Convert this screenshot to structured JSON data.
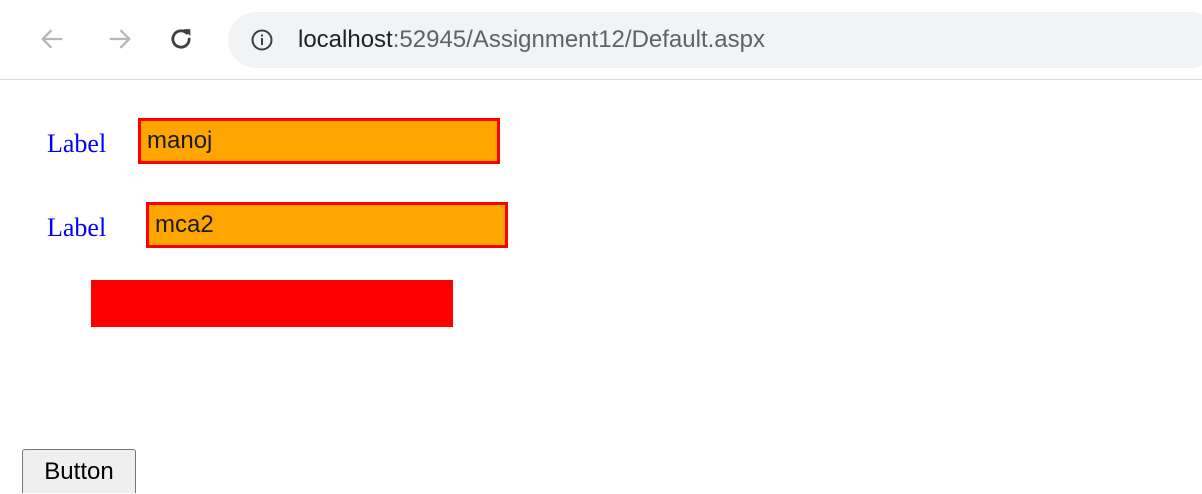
{
  "browser": {
    "url_host": "localhost",
    "url_rest": ":52945/Assignment12/Default.aspx",
    "icons": {
      "back": "back-arrow-icon",
      "forward": "forward-arrow-icon",
      "reload": "reload-icon",
      "info": "info-icon"
    }
  },
  "form": {
    "label1": "Label",
    "textbox1_value": "manoj",
    "label2": "Label",
    "textbox2_value": "mca2",
    "button_label": "Button"
  },
  "colors": {
    "label_text": "#0000ff",
    "textbox_background": "#ffa500",
    "textbox_border": "#ff0000",
    "red_bar": "#ff0000"
  }
}
